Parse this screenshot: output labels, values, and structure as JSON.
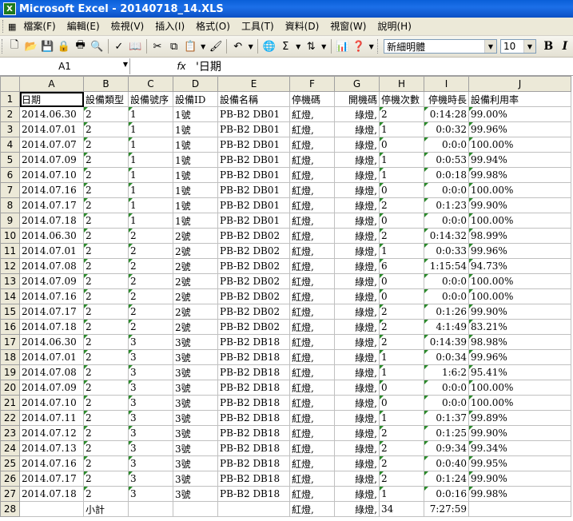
{
  "window": {
    "title": "Microsoft Excel - 20140718_14.XLS"
  },
  "menu": [
    "檔案(F)",
    "編輯(E)",
    "檢視(V)",
    "插入(I)",
    "格式(O)",
    "工具(T)",
    "資料(D)",
    "視窗(W)",
    "說明(H)"
  ],
  "toolbar": {
    "font_name": "新細明體",
    "font_size": "10",
    "bold_label": "B",
    "italic_label": "I"
  },
  "formula": {
    "name_box": "A1",
    "fx_label": "fx",
    "content": "'日期"
  },
  "columns": [
    "A",
    "B",
    "C",
    "D",
    "E",
    "F",
    "G",
    "H",
    "I",
    "J"
  ],
  "header_row": [
    "日期",
    "設備類型",
    "設備號序",
    "設備ID",
    "設備名稱",
    "停機碼",
    "開機碼",
    "停機次數",
    "停機時長",
    "設備利用率"
  ],
  "rows": [
    [
      "2014.06.30",
      "2",
      "1",
      "1號",
      "PB-B2 DB01",
      "紅燈,",
      "綠燈,",
      "2",
      "0:14:28",
      "99.00%"
    ],
    [
      "2014.07.01",
      "2",
      "1",
      "1號",
      "PB-B2 DB01",
      "紅燈,",
      "綠燈,",
      "1",
      "0:0:32",
      "99.96%"
    ],
    [
      "2014.07.07",
      "2",
      "1",
      "1號",
      "PB-B2 DB01",
      "紅燈,",
      "綠燈,",
      "0",
      "0:0:0",
      "100.00%"
    ],
    [
      "2014.07.09",
      "2",
      "1",
      "1號",
      "PB-B2 DB01",
      "紅燈,",
      "綠燈,",
      "1",
      "0:0:53",
      "99.94%"
    ],
    [
      "2014.07.10",
      "2",
      "1",
      "1號",
      "PB-B2 DB01",
      "紅燈,",
      "綠燈,",
      "1",
      "0:0:18",
      "99.98%"
    ],
    [
      "2014.07.16",
      "2",
      "1",
      "1號",
      "PB-B2 DB01",
      "紅燈,",
      "綠燈,",
      "0",
      "0:0:0",
      "100.00%"
    ],
    [
      "2014.07.17",
      "2",
      "1",
      "1號",
      "PB-B2 DB01",
      "紅燈,",
      "綠燈,",
      "2",
      "0:1:23",
      "99.90%"
    ],
    [
      "2014.07.18",
      "2",
      "1",
      "1號",
      "PB-B2 DB01",
      "紅燈,",
      "綠燈,",
      "0",
      "0:0:0",
      "100.00%"
    ],
    [
      "2014.06.30",
      "2",
      "2",
      "2號",
      "PB-B2 DB02",
      "紅燈,",
      "綠燈,",
      "2",
      "0:14:32",
      "98.99%"
    ],
    [
      "2014.07.01",
      "2",
      "2",
      "2號",
      "PB-B2 DB02",
      "紅燈,",
      "綠燈,",
      "1",
      "0:0:33",
      "99.96%"
    ],
    [
      "2014.07.08",
      "2",
      "2",
      "2號",
      "PB-B2 DB02",
      "紅燈,",
      "綠燈,",
      "6",
      "1:15:54",
      "94.73%"
    ],
    [
      "2014.07.09",
      "2",
      "2",
      "2號",
      "PB-B2 DB02",
      "紅燈,",
      "綠燈,",
      "0",
      "0:0:0",
      "100.00%"
    ],
    [
      "2014.07.16",
      "2",
      "2",
      "2號",
      "PB-B2 DB02",
      "紅燈,",
      "綠燈,",
      "0",
      "0:0:0",
      "100.00%"
    ],
    [
      "2014.07.17",
      "2",
      "2",
      "2號",
      "PB-B2 DB02",
      "紅燈,",
      "綠燈,",
      "2",
      "0:1:26",
      "99.90%"
    ],
    [
      "2014.07.18",
      "2",
      "2",
      "2號",
      "PB-B2 DB02",
      "紅燈,",
      "綠燈,",
      "2",
      "4:1:49",
      "83.21%"
    ],
    [
      "2014.06.30",
      "2",
      "3",
      "3號",
      "PB-B2 DB18",
      "紅燈,",
      "綠燈,",
      "2",
      "0:14:39",
      "98.98%"
    ],
    [
      "2014.07.01",
      "2",
      "3",
      "3號",
      "PB-B2 DB18",
      "紅燈,",
      "綠燈,",
      "1",
      "0:0:34",
      "99.96%"
    ],
    [
      "2014.07.08",
      "2",
      "3",
      "3號",
      "PB-B2 DB18",
      "紅燈,",
      "綠燈,",
      "1",
      "1:6:2",
      "95.41%"
    ],
    [
      "2014.07.09",
      "2",
      "3",
      "3號",
      "PB-B2 DB18",
      "紅燈,",
      "綠燈,",
      "0",
      "0:0:0",
      "100.00%"
    ],
    [
      "2014.07.10",
      "2",
      "3",
      "3號",
      "PB-B2 DB18",
      "紅燈,",
      "綠燈,",
      "0",
      "0:0:0",
      "100.00%"
    ],
    [
      "2014.07.11",
      "2",
      "3",
      "3號",
      "PB-B2 DB18",
      "紅燈,",
      "綠燈,",
      "1",
      "0:1:37",
      "99.89%"
    ],
    [
      "2014.07.12",
      "2",
      "3",
      "3號",
      "PB-B2 DB18",
      "紅燈,",
      "綠燈,",
      "2",
      "0:1:25",
      "99.90%"
    ],
    [
      "2014.07.13",
      "2",
      "3",
      "3號",
      "PB-B2 DB18",
      "紅燈,",
      "綠燈,",
      "2",
      "0:9:34",
      "99.34%"
    ],
    [
      "2014.07.16",
      "2",
      "3",
      "3號",
      "PB-B2 DB18",
      "紅燈,",
      "綠燈,",
      "2",
      "0:0:40",
      "99.95%"
    ],
    [
      "2014.07.17",
      "2",
      "3",
      "3號",
      "PB-B2 DB18",
      "紅燈,",
      "綠燈,",
      "2",
      "0:1:24",
      "99.90%"
    ],
    [
      "2014.07.18",
      "2",
      "3",
      "3號",
      "PB-B2 DB18",
      "紅燈,",
      "綠燈,",
      "1",
      "0:0:16",
      "99.98%"
    ]
  ],
  "total_row": [
    "",
    "小計",
    "",
    "",
    "",
    "紅燈,",
    "綠燈,",
    "34",
    "7:27:59",
    ""
  ]
}
